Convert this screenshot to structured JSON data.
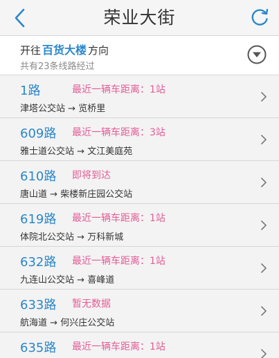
{
  "header": {
    "title": "荣业大街"
  },
  "direction": {
    "prefix": "开往",
    "destination": "百货大楼",
    "suffix": "方向",
    "route_count": "共有23条线路经过"
  },
  "routes": [
    {
      "number": "1路",
      "status": "最近一辆车距离：1站",
      "from": "津塔公交站",
      "arrow": "→",
      "to": "览桥里"
    },
    {
      "number": "609路",
      "status": "最近一辆车距离：3站",
      "from": "雅士道公交站",
      "arrow": "→",
      "to": "文江美庭苑"
    },
    {
      "number": "610路",
      "status": "即将到达",
      "from": "唐山道",
      "arrow": "→",
      "to": "柴楼新庄园公交站"
    },
    {
      "number": "619路",
      "status": "最近一辆车距离：1站",
      "from": "体院北公交站",
      "arrow": "→",
      "to": "万科新城"
    },
    {
      "number": "632路",
      "status": "最近一辆车距离：1站",
      "from": "九连山公交站",
      "arrow": "→",
      "to": "喜峰道"
    },
    {
      "number": "633路",
      "status": "暂无数据",
      "from": "航海道",
      "arrow": "→",
      "to": "何兴庄公交站"
    },
    {
      "number": "635路",
      "status": "最近一辆车距离：1站",
      "from": "",
      "arrow": "",
      "to": ""
    }
  ],
  "colors": {
    "accent": "#2b87c9",
    "status": "#e35c97",
    "row_background": "#f3f3f3"
  },
  "icons": {
    "back": "chevron-left-icon",
    "refresh": "refresh-icon",
    "toggle": "caret-down-circle-icon",
    "row": "chevron-right-icon"
  }
}
